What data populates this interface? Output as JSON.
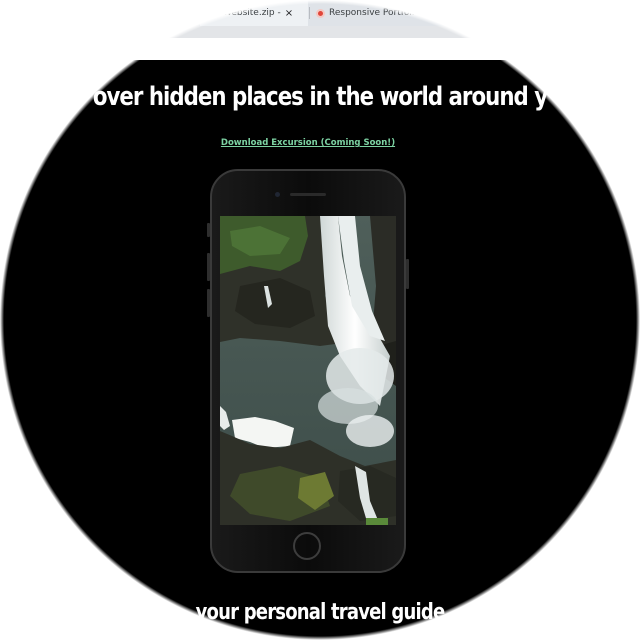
{
  "browser": {
    "tabs": [
      {
        "label": "...o Website.zip -",
        "close": "×"
      },
      {
        "label": "Responsive Portfolio W...",
        "favicon": "opera-icon"
      }
    ]
  },
  "page": {
    "headline": "over hidden places in the world around y",
    "download_link": "Download Excursion (Coming Soon!)",
    "bottom_text": "your personal travel guide",
    "colors": {
      "background": "#000000",
      "headline": "#ffffff",
      "link": "#7dd3a3"
    }
  },
  "phone": {
    "screen_content": "waterfall-video",
    "icons": [
      "speaker-icon",
      "camera-icon",
      "home-button-icon"
    ]
  }
}
